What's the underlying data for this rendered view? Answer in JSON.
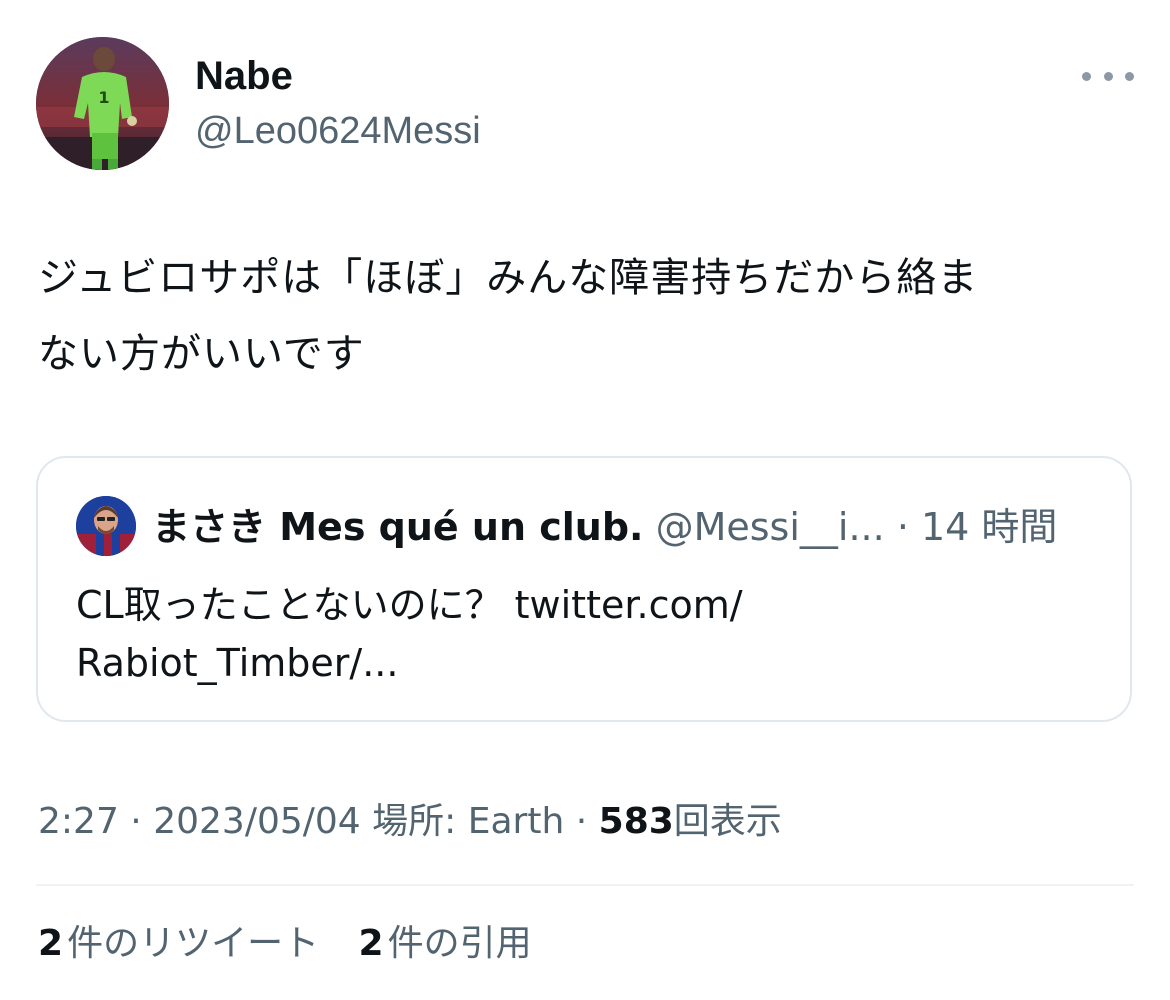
{
  "author": {
    "display_name": "Nabe",
    "handle": "@Leo0624Messi"
  },
  "tweet": {
    "text_lines": [
      "ジュビロサポは「ほぼ」みんな障害持ちだから絡ま",
      "ない方がいいです"
    ]
  },
  "quoted_tweet": {
    "display_name": "まさき Mes qué un club.",
    "handle": "@Messi__i...",
    "separator": "·",
    "time": "14 時間",
    "text_lines": [
      "CL取ったことないのに？ twitter.com/",
      "Rabiot_Timber/..."
    ]
  },
  "meta": {
    "time": "2:27",
    "sep1": "·",
    "date": "2023/05/04",
    "location": "場所: Earth",
    "sep2": "·",
    "views_count": "583",
    "views_label": "回表示"
  },
  "stats": {
    "retweets_count": "2",
    "retweets_label": "件のリツイート",
    "quotes_count": "2",
    "quotes_label": "件の引用"
  },
  "icons": {
    "more": "more-horizontal-icon"
  },
  "colors": {
    "text_primary": "#0f1419",
    "text_secondary": "#536471",
    "border": "#e1e8ed",
    "keeper_kit": "#7ed957"
  }
}
